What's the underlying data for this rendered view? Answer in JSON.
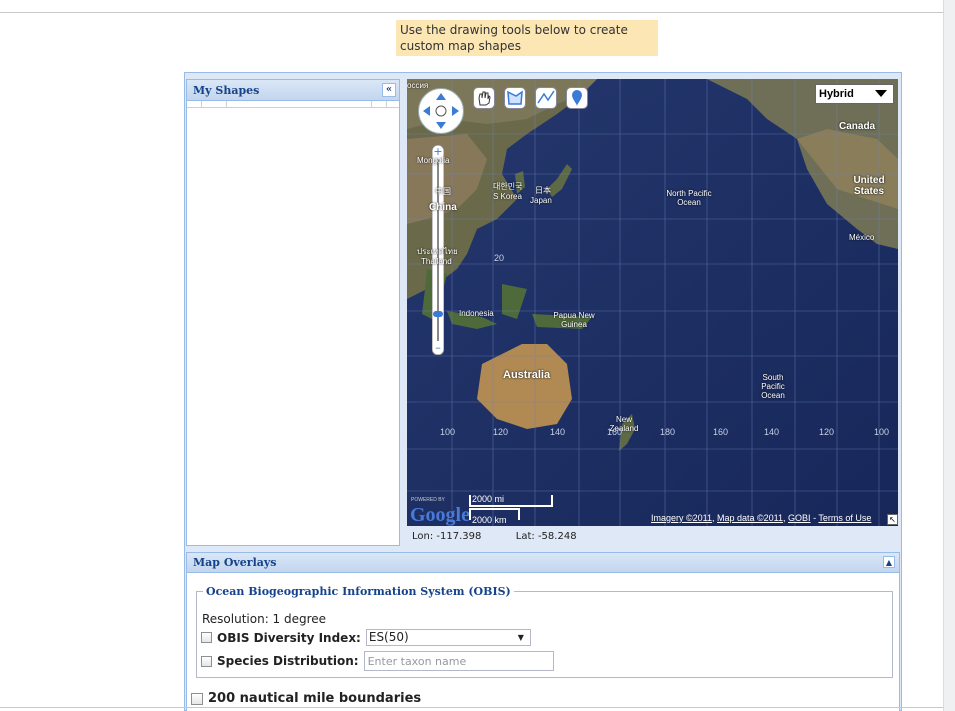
{
  "hint": {
    "text": "Use the drawing tools below to create custom map shapes"
  },
  "shapes_panel": {
    "title": "My Shapes",
    "collapse_glyph": "«"
  },
  "map": {
    "map_type": "Hybrid",
    "tools": [
      "hand-tool-icon",
      "polygon-tool-icon",
      "line-tool-icon",
      "marker-tool-icon"
    ],
    "labels": {
      "russia": "оссия",
      "mongolia": "Mongolia",
      "china_cn": "中国",
      "china": "China",
      "korea_kr": "대한민국",
      "korea": "S Korea",
      "japan_jp": "日本",
      "japan": "Japan",
      "thailand_th": "ประเทศไทย",
      "thailand": "Thailand",
      "indonesia": "Indonesia",
      "png": "Papua New Guinea",
      "australia": "Australia",
      "nz": "New Zealand",
      "north_pacific": "North Pacific Ocean",
      "south_pacific": "South Pacific Ocean",
      "canada": "Canada",
      "usa": "United States",
      "mexico": "México"
    },
    "grid_labels": [
      "100",
      "120",
      "140",
      "160",
      "180",
      "160",
      "140",
      "120",
      "100"
    ],
    "grid_lat": [
      "20"
    ],
    "google": "Google",
    "powered_by": "POWERED BY",
    "scale_mi": "2000 mi",
    "scale_km": "2000 km",
    "imagery": "Imagery ©2011",
    "map_data": "Map data ©2011",
    "gobi": "GOBI",
    "terms": "Terms of Use"
  },
  "coords": {
    "lon_label": "Lon:",
    "lon": "-117.398",
    "lat_label": "Lat:",
    "lat": "-58.248"
  },
  "overlays": {
    "title": "Map Overlays",
    "obis": {
      "legend": "Ocean Biogeographic Information System (OBIS)",
      "resolution": "Resolution: 1 degree",
      "diversity_label": "OBIS Diversity Index:",
      "diversity_value": "ES(50)",
      "species_label": "Species Distribution:",
      "species_placeholder": "Enter taxon name"
    },
    "nautical": "200 nautical mile boundaries"
  }
}
